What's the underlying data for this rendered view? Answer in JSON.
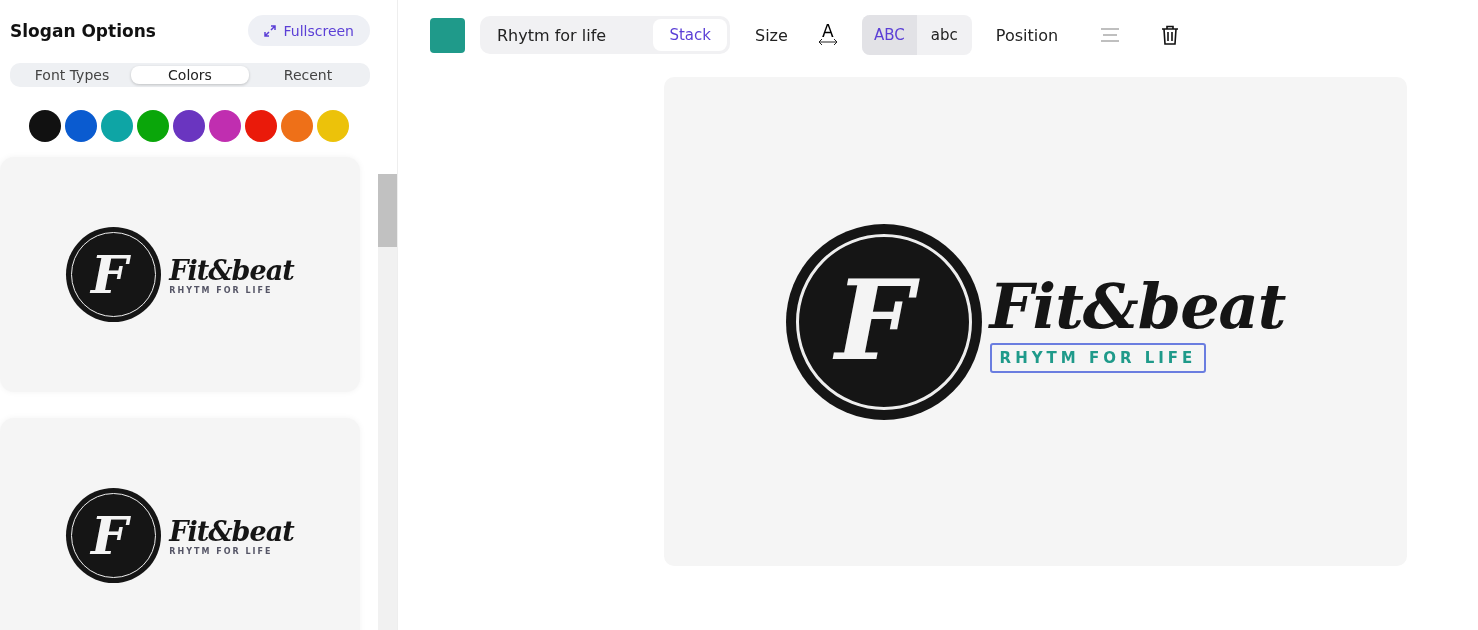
{
  "sidebar": {
    "title": "Slogan Options",
    "fullscreen_button": "Fullscreen",
    "tabs": [
      {
        "label": "Font Types",
        "selected": false
      },
      {
        "label": "Colors",
        "selected": true
      },
      {
        "label": "Recent",
        "selected": false
      }
    ],
    "swatches": [
      {
        "color": "#111111"
      },
      {
        "color": "#0a5bd0"
      },
      {
        "color": "#0ea5a5"
      },
      {
        "color": "#0aa60a"
      },
      {
        "color": "#6a35c0"
      },
      {
        "color": "#c02eb0"
      },
      {
        "color": "#ea1a0a"
      },
      {
        "color": "#ee7018"
      },
      {
        "color": "#ecc20a"
      }
    ],
    "previews": [
      {
        "monogram": "F",
        "name": "Fit&beat",
        "slogan": "RHYTM FOR LIFE"
      },
      {
        "monogram": "F",
        "name": "Fit&beat",
        "slogan": "RHYTM FOR LIFE"
      }
    ]
  },
  "toolbar": {
    "slogan_swatch": {
      "color": "#1f9a8a"
    },
    "slogan_text": "Rhytm for life",
    "stack_button": "Stack",
    "size_label": "Size",
    "spacing_glyph": "A",
    "case_options": [
      {
        "label": "ABC",
        "selected": true
      },
      {
        "label": "abc",
        "selected": false
      }
    ],
    "position_label": "Position"
  },
  "canvas": {
    "monogram": "F",
    "name": "Fit&beat",
    "slogan": "RHYTM FOR LIFE",
    "slogan_selected": true
  }
}
